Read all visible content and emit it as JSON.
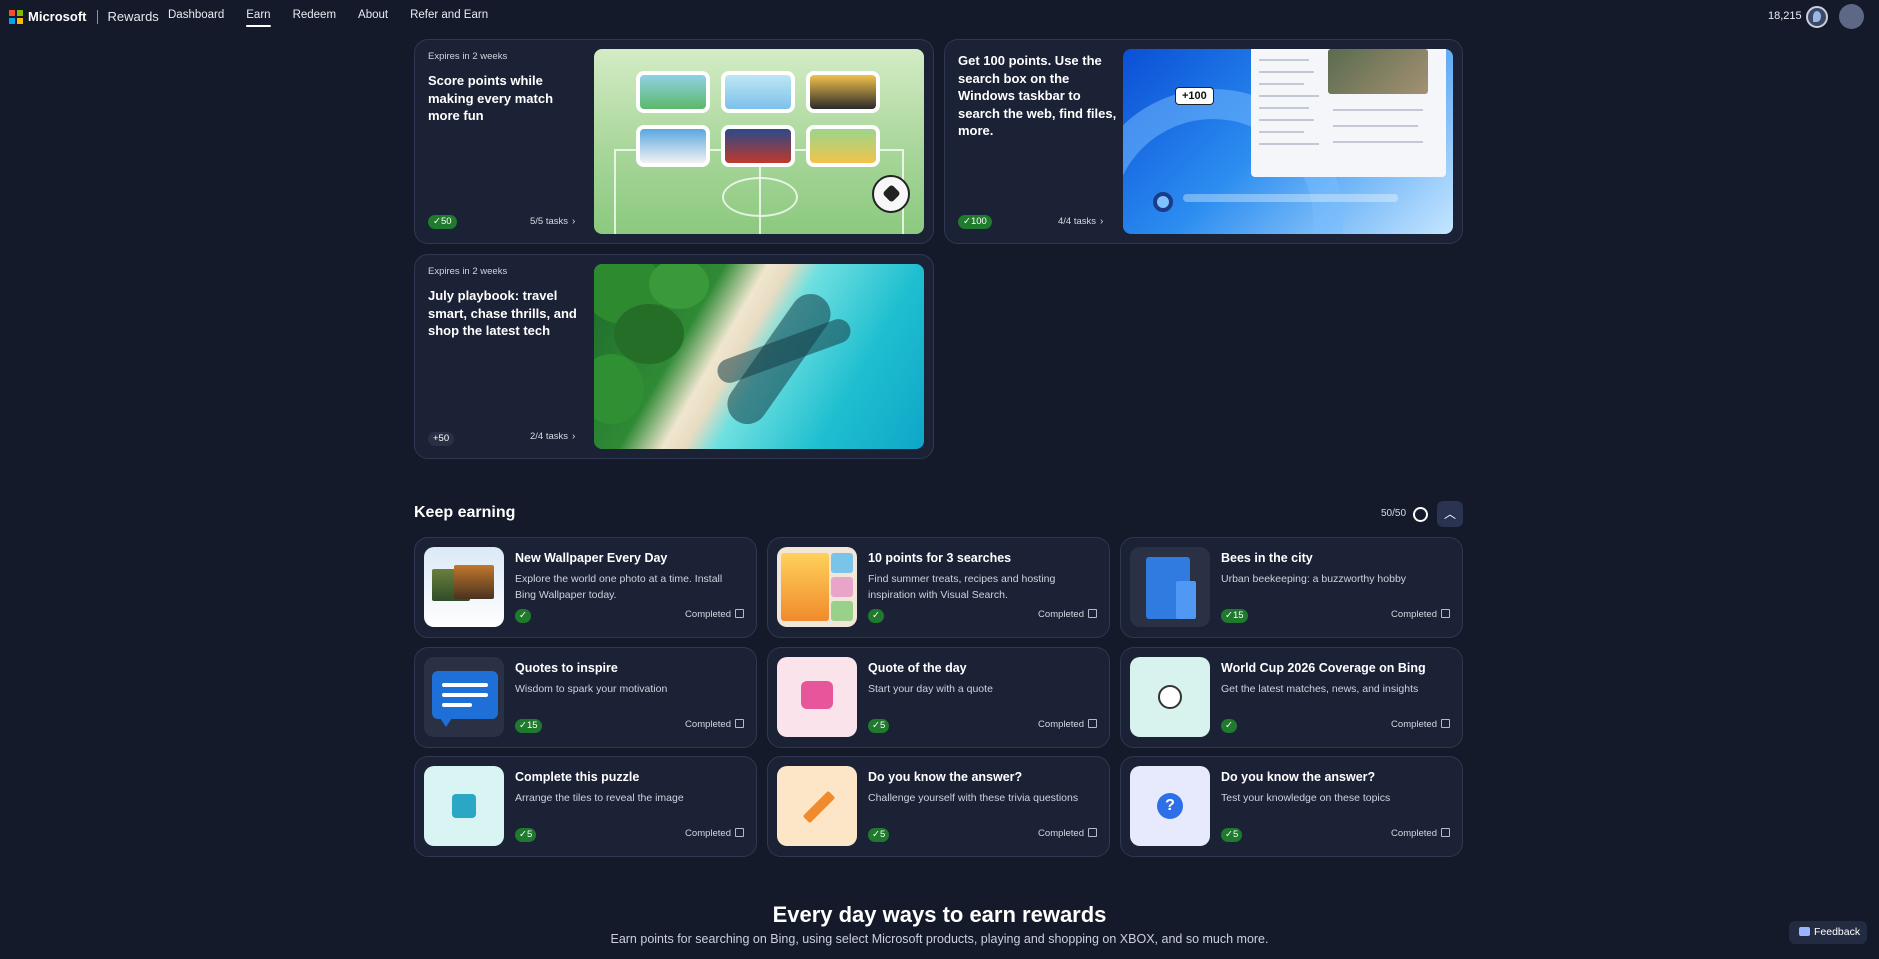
{
  "nav": {
    "brand_ms": "Microsoft",
    "brand_product": "Rewards",
    "links": [
      {
        "label": "Dashboard",
        "active": false
      },
      {
        "label": "Earn",
        "active": true
      },
      {
        "label": "Redeem",
        "active": false
      },
      {
        "label": "About",
        "active": false
      },
      {
        "label": "Refer and Earn",
        "active": false
      }
    ],
    "points": "18,215"
  },
  "promos": [
    {
      "expires": "Expires in 2 weeks",
      "title": "Score points while making every match more fun",
      "points": "✓50",
      "tasks": "5/5 tasks"
    },
    {
      "expires": "",
      "title": "Get 100 points. Use the search box on the Windows taskbar to search the web, find files, more.",
      "points": "✓100",
      "tasks": "4/4 tasks",
      "badge": "+100"
    },
    {
      "expires": "Expires in 2 weeks",
      "title": "July playbook: travel smart, chase thrills, and shop the latest tech",
      "points": "+50",
      "tasks": "2/4 tasks"
    }
  ],
  "keep_earning": {
    "title": "Keep earning",
    "count": "50/50",
    "cards": [
      {
        "title": "New Wallpaper Every Day",
        "desc": "Explore the world one photo at a time. Install Bing Wallpaper today.",
        "points": "✓",
        "status": "Completed"
      },
      {
        "title": "10 points for 3 searches",
        "desc": "Find summer treats, recipes and hosting inspiration with Visual Search.",
        "points": "✓",
        "status": "Completed"
      },
      {
        "title": "Bees in the city",
        "desc": "Urban beekeeping: a buzzworthy hobby",
        "points": "✓15",
        "status": "Completed"
      },
      {
        "title": "Quotes to inspire",
        "desc": "Wisdom to spark your motivation",
        "points": "✓15",
        "status": "Completed"
      },
      {
        "title": "Quote of the day",
        "desc": "Start your day with a quote",
        "points": "✓5",
        "status": "Completed"
      },
      {
        "title": "World Cup 2026 Coverage on Bing",
        "desc": "Get the latest matches, news, and insights",
        "points": "✓",
        "status": "Completed"
      },
      {
        "title": "Complete this puzzle",
        "desc": "Arrange the tiles to reveal the image",
        "points": "✓5",
        "status": "Completed"
      },
      {
        "title": "Do you know the answer?",
        "desc": "Challenge yourself with these trivia questions",
        "points": "✓5",
        "status": "Completed"
      },
      {
        "title": "Do you know the answer?",
        "desc": "Test your knowledge on these topics",
        "points": "✓5",
        "status": "Completed"
      }
    ]
  },
  "every_day": {
    "title": "Every day ways to earn rewards",
    "subtitle": "Earn points for searching on Bing, using select Microsoft products, playing and shopping on XBOX, and so much more."
  },
  "feedback_label": "Feedback",
  "colors": {
    "accent_green": "#1f7a2e",
    "background": "#141a2a",
    "card": "#1c2235"
  }
}
